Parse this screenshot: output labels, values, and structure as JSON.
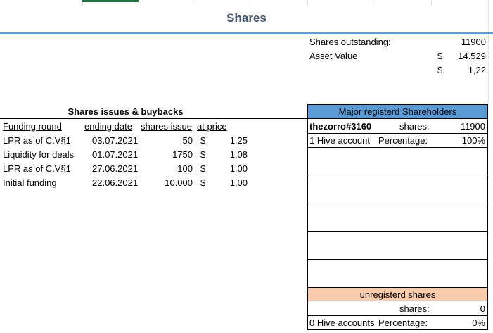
{
  "sheet": {
    "title": "Shares"
  },
  "summary": {
    "outstanding_label": "Shares outstanding:",
    "outstanding_value": "11900",
    "asset_label": "Asset Value",
    "asset_currency": "$",
    "asset_value": "14.529",
    "price_currency": "$",
    "price_value": "1,22"
  },
  "issues": {
    "title": "Shares issues & buybacks",
    "headers": [
      "Funding round",
      "ending date",
      "shares issue",
      "at price"
    ],
    "rows": [
      {
        "round": "LPR as of C.V§1",
        "date": "03.07.2021",
        "shares": "50",
        "currency": "$",
        "price": "1,25"
      },
      {
        "round": "Liquidity for deals",
        "date": "01.07.2021",
        "shares": "1750",
        "currency": "$",
        "price": "1,08"
      },
      {
        "round": "LPR as of C.V§1",
        "date": "27.06.2021",
        "shares": "100",
        "currency": "$",
        "price": "1,00"
      },
      {
        "round": "Initial funding",
        "date": "22.06.2021",
        "shares": "10.000",
        "currency": "$",
        "price": "1,00"
      }
    ]
  },
  "holders": {
    "title": "Major registerd Shareholders",
    "name": "thezorro#3160",
    "shares_label": "shares:",
    "shares_value": "11900",
    "account_label": "1 Hive account",
    "pct_label": "Percentage:",
    "pct_value": "100%"
  },
  "unregistered": {
    "title": "unregisterd shares",
    "shares_label": "shares:",
    "shares_value": "0",
    "account_label": "0 Hive accounts",
    "pct_label": "Percentage:",
    "pct_value": "0%"
  },
  "colors": {
    "title_text": "#44546a",
    "accent_blue": "#5b9bd5",
    "peach": "#f8cbad",
    "excel_green": "#217346"
  }
}
